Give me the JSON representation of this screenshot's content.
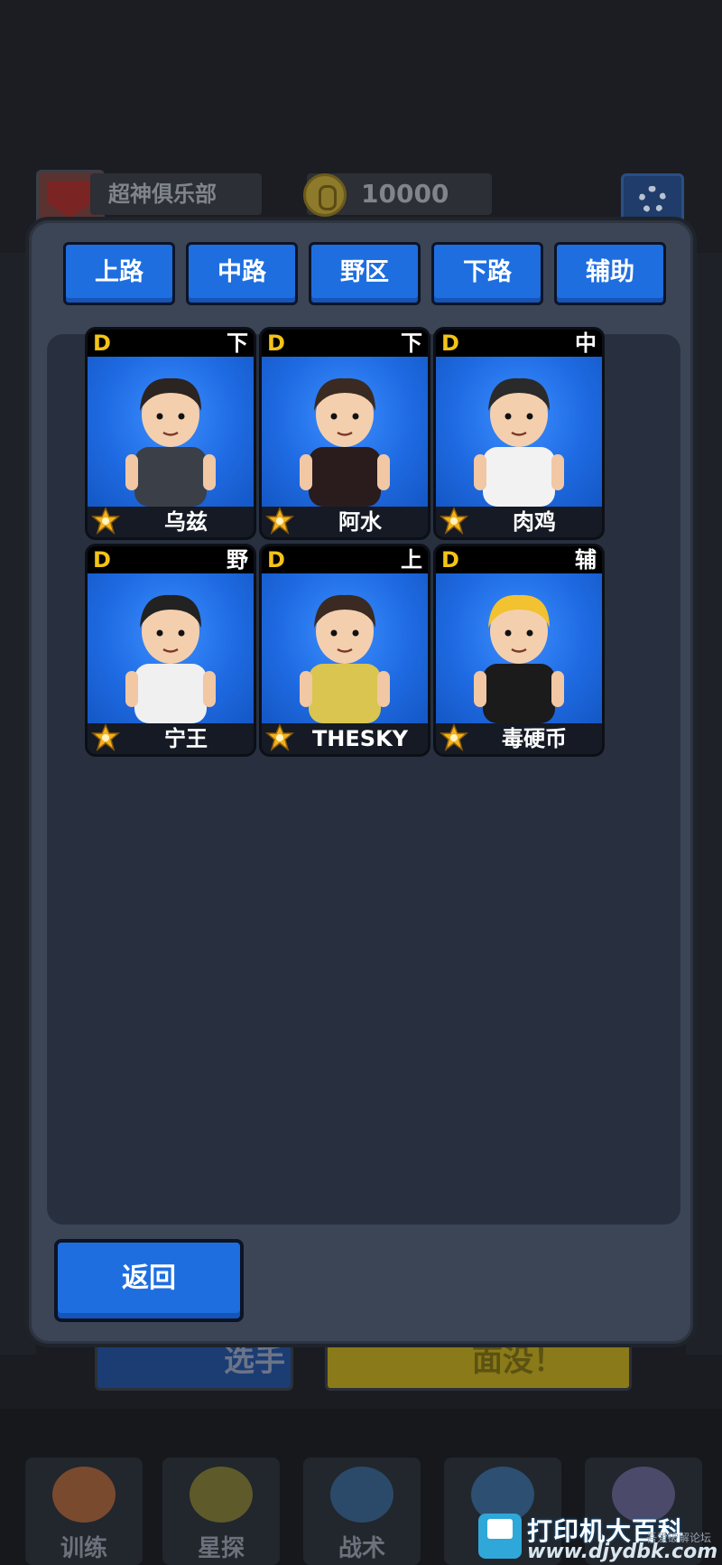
{
  "header": {
    "club_name": "超神俱乐部",
    "coins": "10000"
  },
  "tabs": [
    {
      "label": "上路"
    },
    {
      "label": "中路"
    },
    {
      "label": "野区"
    },
    {
      "label": "下路"
    },
    {
      "label": "辅助"
    }
  ],
  "players": [
    {
      "grade": "D",
      "role": "下",
      "name": "乌兹",
      "shirt": "#3b3f48",
      "hair": "#2b2420"
    },
    {
      "grade": "D",
      "role": "下",
      "name": "阿水",
      "shirt": "#2a1c1c",
      "hair": "#3a2a22"
    },
    {
      "grade": "D",
      "role": "中",
      "name": "肉鸡",
      "shirt": "#f2f2f2",
      "hair": "#2a2a2a"
    },
    {
      "grade": "D",
      "role": "野",
      "name": "宁王",
      "shirt": "#f0f0f0",
      "hair": "#222222"
    },
    {
      "grade": "D",
      "role": "上",
      "name": "THESKY",
      "shirt": "#d9c550",
      "hair": "#3a2a22"
    },
    {
      "grade": "D",
      "role": "辅",
      "name": "毒硬币",
      "shirt": "#1b1b1b",
      "hair": "#f2c230"
    }
  ],
  "back_button": "返回",
  "background": {
    "btn_blue": "选手",
    "btn_yellow": "面没！",
    "nav": [
      "训练",
      "星探",
      "战术",
      "",
      ""
    ]
  },
  "watermark": {
    "title": "打印机大百科",
    "url": "www.djydbk.com",
    "small": "吾爱破解论坛"
  },
  "colors": {
    "tab_blue": "#1e6ee0",
    "modal": "#3b4556",
    "panel": "#28303f",
    "grade_yellow": "#f3c316"
  }
}
